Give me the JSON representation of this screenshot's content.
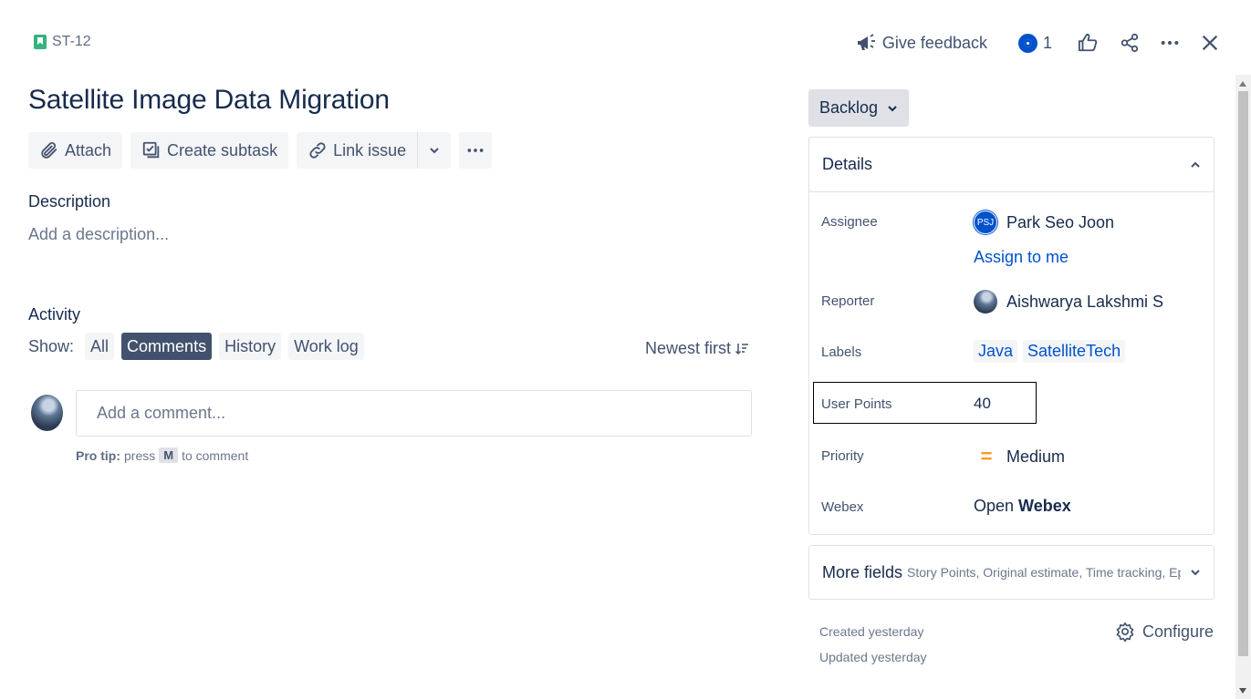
{
  "issue_key": "ST-12",
  "header": {
    "feedback_label": "Give feedback",
    "watch_count": "1"
  },
  "title": "Satellite Image Data Migration",
  "toolbar": {
    "attach": "Attach",
    "create_subtask": "Create subtask",
    "link_issue": "Link issue"
  },
  "description": {
    "label": "Description",
    "placeholder": "Add a description..."
  },
  "activity": {
    "label": "Activity",
    "show_label": "Show:",
    "filters": [
      "All",
      "Comments",
      "History",
      "Work log"
    ],
    "active_filter": "Comments",
    "sort_label": "Newest first",
    "comment_placeholder": "Add a comment...",
    "pro_tip_bold": "Pro tip:",
    "pro_tip_press": "press",
    "pro_tip_key": "M",
    "pro_tip_suffix": "to comment"
  },
  "status": "Backlog",
  "details": {
    "heading": "Details",
    "assignee_label": "Assignee",
    "assignee_initials": "PSJ",
    "assignee_name": "Park Seo Joon",
    "assign_to_me": "Assign to me",
    "reporter_label": "Reporter",
    "reporter_name": "Aishwarya Lakshmi S",
    "labels_label": "Labels",
    "labels": [
      "Java",
      "SatelliteTech"
    ],
    "user_points_label": "User Points",
    "user_points_value": "40",
    "priority_label": "Priority",
    "priority_value": "Medium",
    "webex_label": "Webex",
    "webex_open": "Open",
    "webex_name": "Webex"
  },
  "more_fields": {
    "title": "More fields",
    "subtitle": "Story Points, Original estimate, Time tracking, Epic ..."
  },
  "meta": {
    "created": "Created yesterday",
    "updated": "Updated yesterday",
    "configure": "Configure"
  },
  "colors": {
    "primary": "#0052cc",
    "story": "#36b37e",
    "priority_medium": "#ff991f",
    "active_pill": "#42526e"
  }
}
